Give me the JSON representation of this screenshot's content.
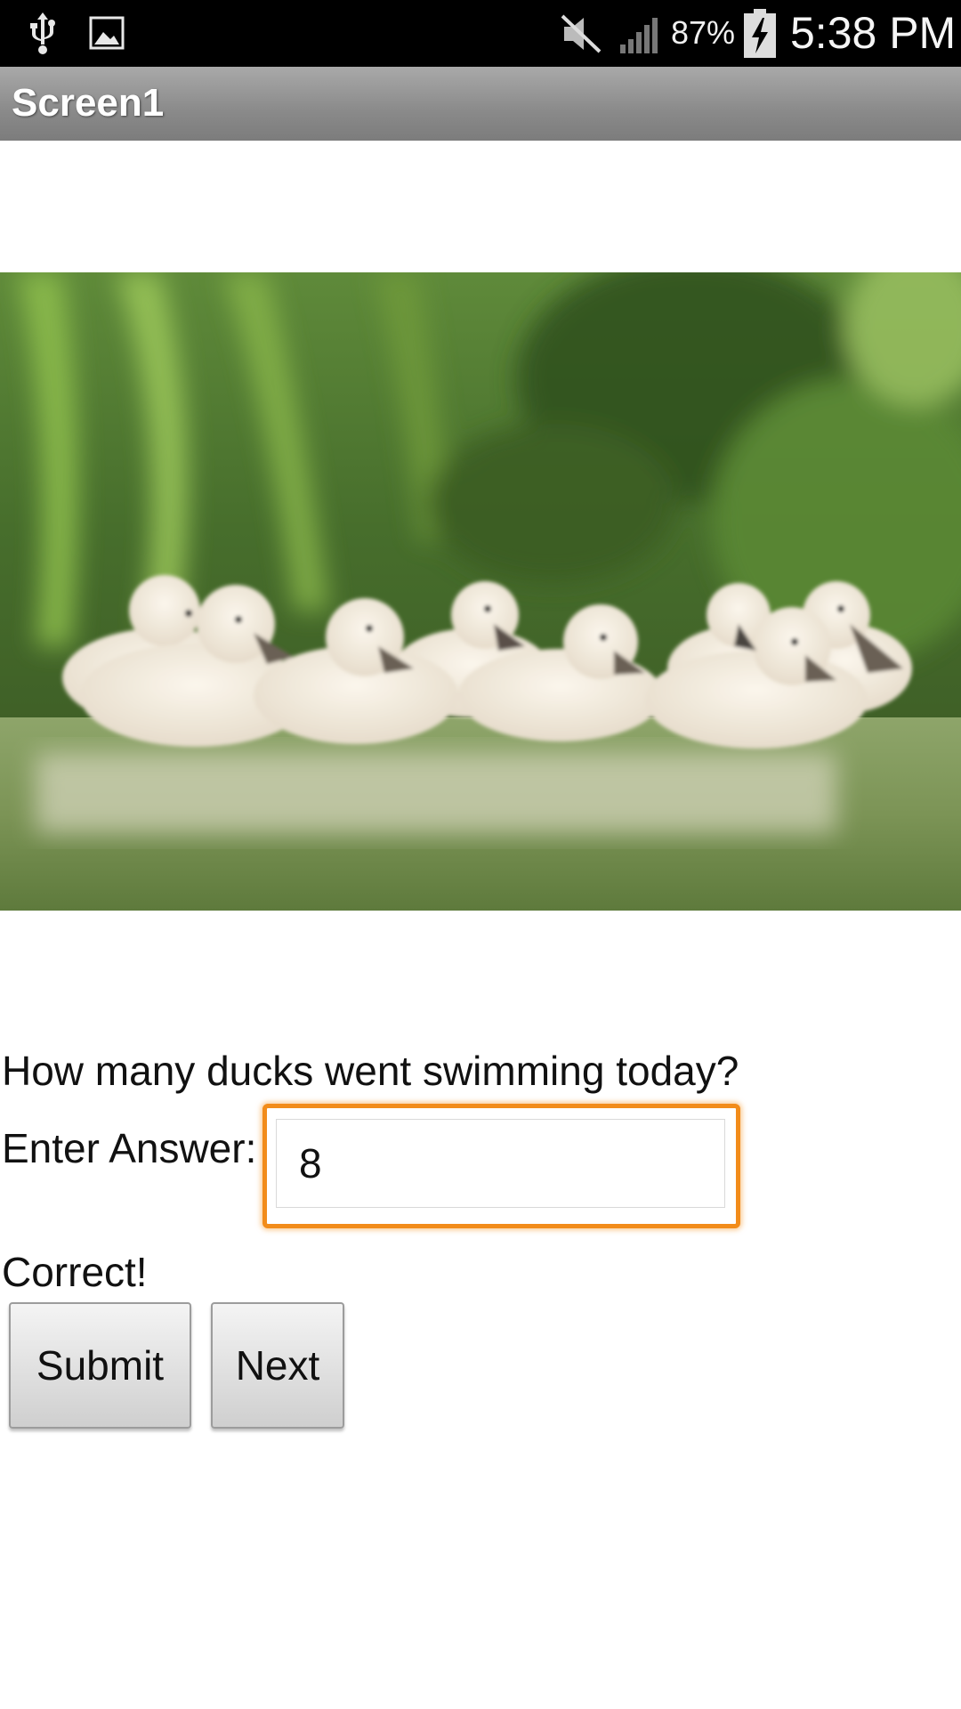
{
  "status_bar": {
    "battery_percent": "87%",
    "time": "5:38 PM",
    "icons": [
      "usb-icon",
      "gallery-icon",
      "mute-icon",
      "signal-icon",
      "battery-charging-icon"
    ]
  },
  "app": {
    "title": "Screen1"
  },
  "photo": {
    "subject": "swan-cygnets-image"
  },
  "quiz": {
    "question": "How many ducks went swimming today?",
    "answer_label": "Enter Answer:",
    "answer_value": "8",
    "result": "Correct!"
  },
  "buttons": {
    "submit": "Submit",
    "next": "Next"
  },
  "colors": {
    "focus_border": "#f28c1a",
    "title_bar": "#8a8a8a",
    "status_bar": "#000000"
  }
}
